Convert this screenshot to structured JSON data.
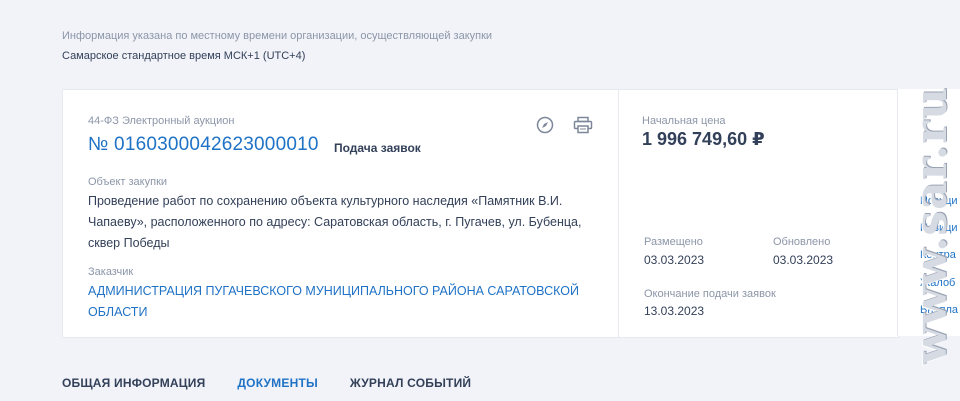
{
  "timezone": {
    "note": "Информация указана по местному времени организации, осуществляющей закупки",
    "value": "Самарское стандартное время МСК+1 (UTC+4)"
  },
  "purchase": {
    "law_type": "44-ФЗ Электронный аукцион",
    "number": "№ 0160300042623000010",
    "status": "Подача заявок",
    "object_label": "Объект закупки",
    "object_text": "Проведение работ по сохранению объекта культурного наследия «Памятник В.И. Чапаеву», расположенного по адресу: Саратовская область, г. Пугачев, ул. Бубенца, сквер Победы",
    "customer_label": "Заказчик",
    "customer_name": "АДМИНИСТРАЦИЯ ПУГАЧЕВСКОГО МУНИЦИПАЛЬНОГО РАЙОНА САРАТОВСКОЙ ОБЛАСТИ"
  },
  "price": {
    "label": "Начальная цена",
    "value": "1 996 749,60 ₽"
  },
  "dates": {
    "posted_label": "Размещено",
    "posted_value": "03.03.2023",
    "updated_label": "Обновлено",
    "updated_value": "03.03.2023",
    "deadline_label": "Окончание подачи заявок",
    "deadline_value": "13.03.2023"
  },
  "side_links": [
    "Позици",
    "Позици",
    "Контра",
    "Жалоб",
    "Внепла"
  ],
  "watermark": "www.sar.ru",
  "tabs": [
    {
      "label": "ОБЩАЯ ИНФОРМАЦИЯ"
    },
    {
      "label": "ДОКУМЕНТЫ"
    },
    {
      "label": "ЖУРНАЛ СОБЫТИЙ"
    }
  ],
  "icons": {
    "compass": "compass-icon",
    "print": "printer-icon"
  },
  "colors": {
    "accent": "#1f72c6",
    "text": "#334059",
    "muted": "#8c96a8",
    "background": "#f1f3f8"
  }
}
